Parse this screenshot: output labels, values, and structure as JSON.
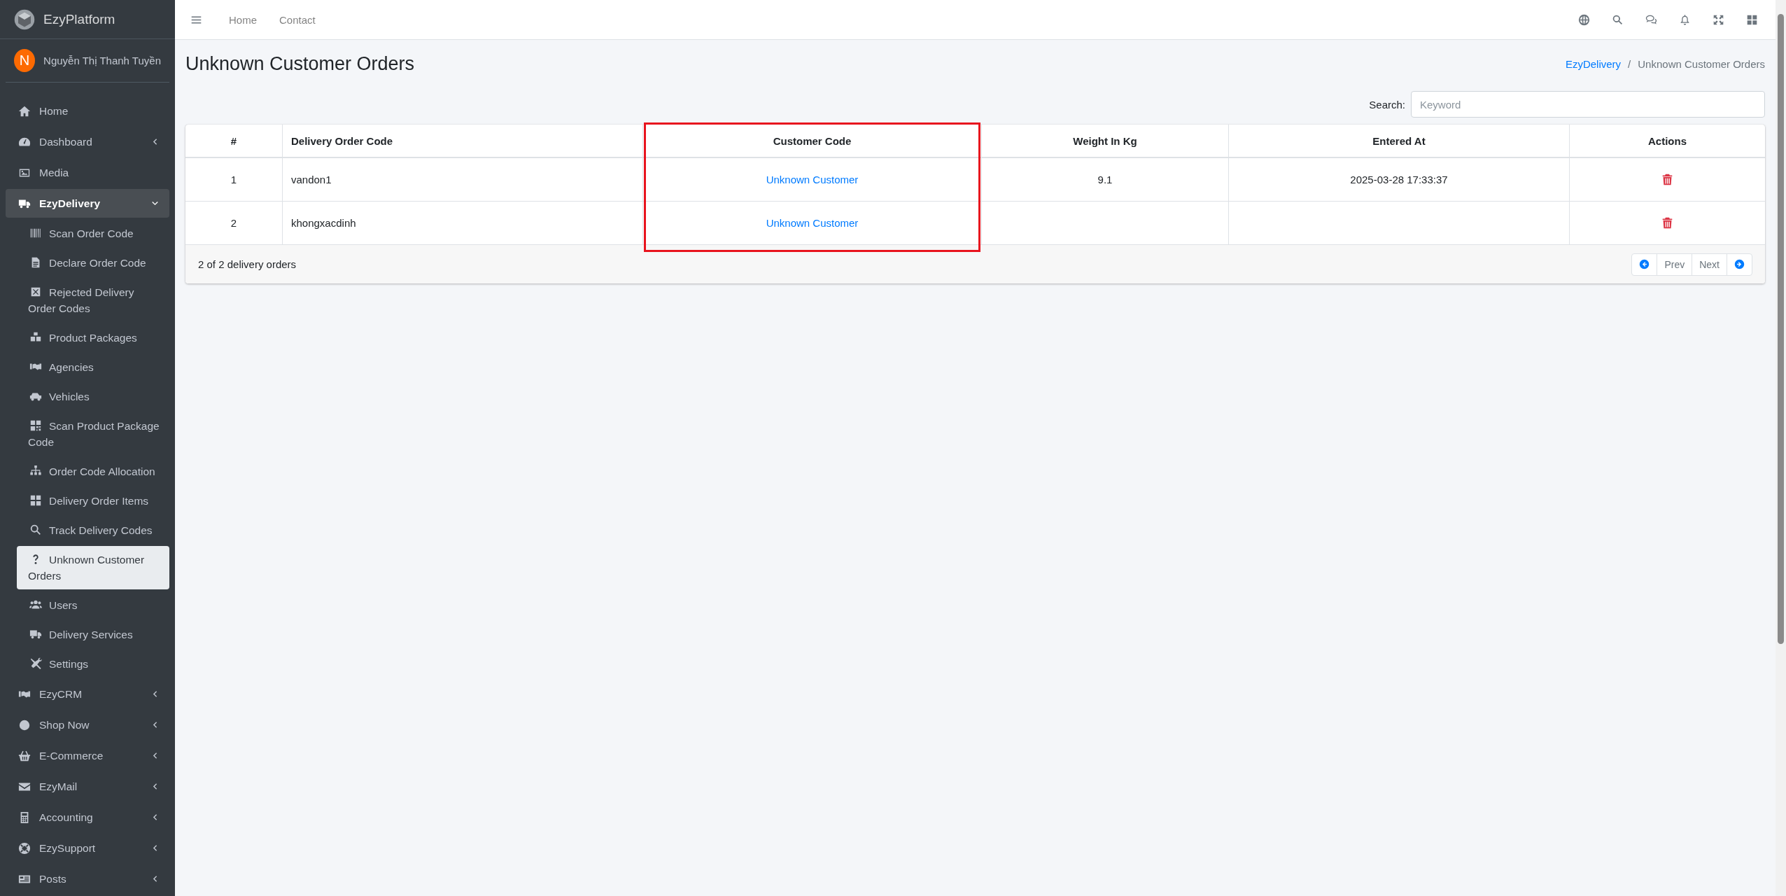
{
  "brand": {
    "name": "EzyPlatform"
  },
  "user": {
    "initial": "N",
    "name": "Nguyễn Thị Thanh Tuyền"
  },
  "sidebar": {
    "items": [
      {
        "label": "Home",
        "kind": "link",
        "selected": false
      },
      {
        "label": "Dashboard",
        "kind": "group",
        "expanded": false,
        "selected": false
      },
      {
        "label": "Media",
        "kind": "link",
        "selected": false
      },
      {
        "label": "EzyDelivery",
        "kind": "group",
        "expanded": true,
        "selected": true,
        "children": [
          {
            "label": "Scan Order Code",
            "selected": false
          },
          {
            "label": "Declare Order Code",
            "selected": false
          },
          {
            "label": "Rejected Delivery Order Codes",
            "selected": false
          },
          {
            "label": "Product Packages",
            "selected": false
          },
          {
            "label": "Agencies",
            "selected": false
          },
          {
            "label": "Vehicles",
            "selected": false
          },
          {
            "label": "Scan Product Package Code",
            "selected": false
          },
          {
            "label": "Order Code Allocation",
            "selected": false
          },
          {
            "label": "Delivery Order Items",
            "selected": false
          },
          {
            "label": "Track Delivery Codes",
            "selected": false
          },
          {
            "label": "Unknown Customer Orders",
            "selected": true
          },
          {
            "label": "Users",
            "selected": false
          },
          {
            "label": "Delivery Services",
            "selected": false
          },
          {
            "label": "Settings",
            "selected": false
          }
        ]
      },
      {
        "label": "EzyCRM",
        "kind": "group",
        "expanded": false,
        "selected": false
      },
      {
        "label": "Shop Now",
        "kind": "group",
        "expanded": false,
        "selected": false
      },
      {
        "label": "E-Commerce",
        "kind": "group",
        "expanded": false,
        "selected": false
      },
      {
        "label": "EzyMail",
        "kind": "group",
        "expanded": false,
        "selected": false
      },
      {
        "label": "Accounting",
        "kind": "group",
        "expanded": false,
        "selected": false
      },
      {
        "label": "EzySupport",
        "kind": "group",
        "expanded": false,
        "selected": false
      },
      {
        "label": "Posts",
        "kind": "group",
        "expanded": false,
        "selected": false
      }
    ]
  },
  "topbar": {
    "links": [
      "Home",
      "Contact"
    ]
  },
  "page": {
    "title": "Unknown Customer Orders",
    "breadcrumb_separator": "/",
    "breadcrumb": [
      {
        "label": "EzyDelivery",
        "kind": "link"
      },
      {
        "label": "Unknown Customer Orders",
        "kind": "current"
      }
    ]
  },
  "search": {
    "label": "Search:",
    "placeholder": "Keyword"
  },
  "table": {
    "columns": [
      {
        "label": "#",
        "highlighted": false
      },
      {
        "label": "Delivery Order Code",
        "highlighted": false
      },
      {
        "label": "Customer Code",
        "highlighted": true
      },
      {
        "label": "Weight In Kg",
        "highlighted": false
      },
      {
        "label": "Entered At",
        "highlighted": false
      },
      {
        "label": "Actions",
        "highlighted": false
      }
    ],
    "rows": [
      {
        "index": "1",
        "code": "vandon1",
        "customer": "Unknown Customer",
        "weight": "9.1",
        "entered_at": "2025-03-28 17:33:37"
      },
      {
        "index": "2",
        "code": "khongxacdinh",
        "customer": "Unknown Customer"
      }
    ]
  },
  "footer": {
    "summary": "2 of 2 delivery orders",
    "prev": "Prev",
    "next": "Next"
  }
}
